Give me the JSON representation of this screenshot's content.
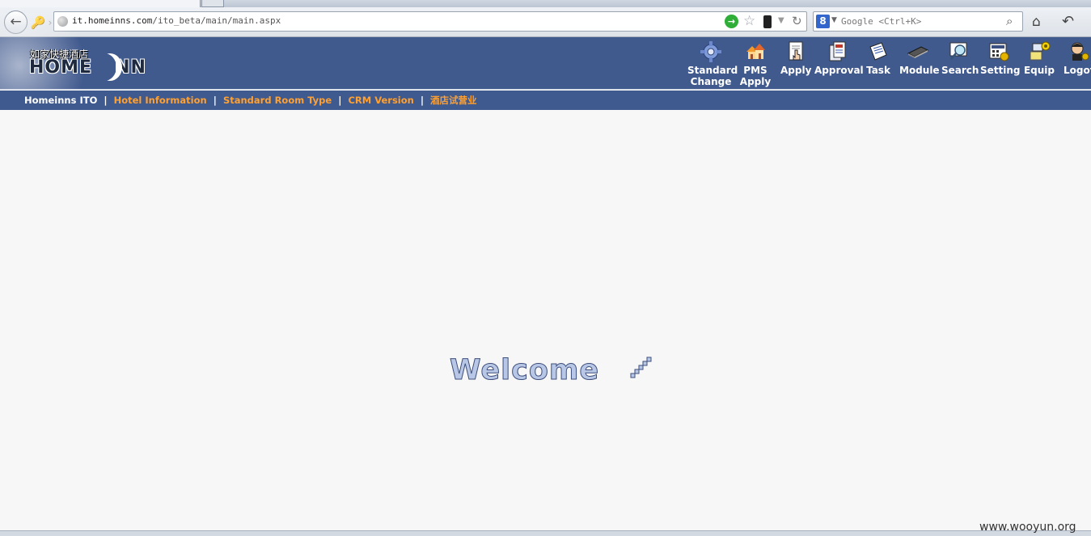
{
  "browser": {
    "url_host": "it.homeinns.com",
    "url_path": "/ito_beta/main/main.aspx",
    "search_placeholder": "Google <Ctrl+K>",
    "search_engine_letter": "8"
  },
  "header": {
    "logo_cn": "如家快捷酒店",
    "logo_en_left": "HOME",
    "logo_en_right": "NN",
    "nav": [
      {
        "line1": "Standard",
        "line2": "Change",
        "icon": "gear-icon"
      },
      {
        "line1": "PMS",
        "line2": "Apply",
        "icon": "houses-icon"
      },
      {
        "line1": "",
        "line2": "Apply",
        "icon": "apply-document-icon"
      },
      {
        "line1": "",
        "line2": "Approval",
        "icon": "approval-document-icon"
      },
      {
        "line1": "",
        "line2": "Task",
        "icon": "task-notes-icon"
      },
      {
        "line1": "",
        "line2": "Module",
        "icon": "memory-chip-icon"
      },
      {
        "line1": "",
        "line2": "Search",
        "icon": "magnifier-icon"
      },
      {
        "line1": "",
        "line2": "Setting",
        "icon": "settings-calculator-icon"
      },
      {
        "line1": "",
        "line2": "Equip",
        "icon": "equipment-icon"
      },
      {
        "line1": "",
        "line2": "Logof",
        "icon": "logoff-user-icon"
      }
    ]
  },
  "breadcrumb": {
    "home": "Homeinns ITO",
    "links": [
      "Hotel Information",
      "Standard Room Type",
      "CRM Version",
      "酒店试营业"
    ],
    "separator": "|"
  },
  "content": {
    "welcome": "Welcome"
  },
  "watermark": "www.wooyun.org",
  "colors": {
    "header_bg": "#415a8e",
    "link_orange": "#ffa031"
  }
}
